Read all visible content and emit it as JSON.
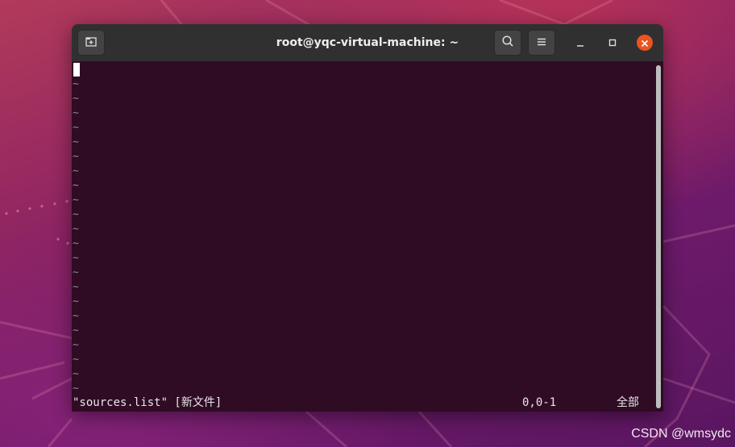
{
  "window": {
    "title": "root@yqc-virtual-machine: ~"
  },
  "icons": {
    "new_tab": "new-tab-icon",
    "search": "search-icon",
    "menu": "hamburger-menu-icon",
    "minimize": "minimize-icon",
    "maximize": "maximize-icon",
    "close": "close-icon"
  },
  "colors": {
    "terminal_bg": "#2f0b24",
    "titlebar_bg": "#303030",
    "close_button": "#e95420"
  },
  "editor": {
    "empty_line_marker": "~",
    "empty_lines": [
      "~",
      "~",
      "~",
      "~",
      "~",
      "~",
      "~",
      "~",
      "~",
      "~",
      "~",
      "~",
      "~",
      "~",
      "~",
      "~",
      "~",
      "~",
      "~",
      "~",
      "~",
      "~"
    ],
    "status_file": "\"sources.list\" [新文件]",
    "status_position": "0,0-1",
    "status_scroll": "全部"
  },
  "watermark": "CSDN @wmsydc"
}
